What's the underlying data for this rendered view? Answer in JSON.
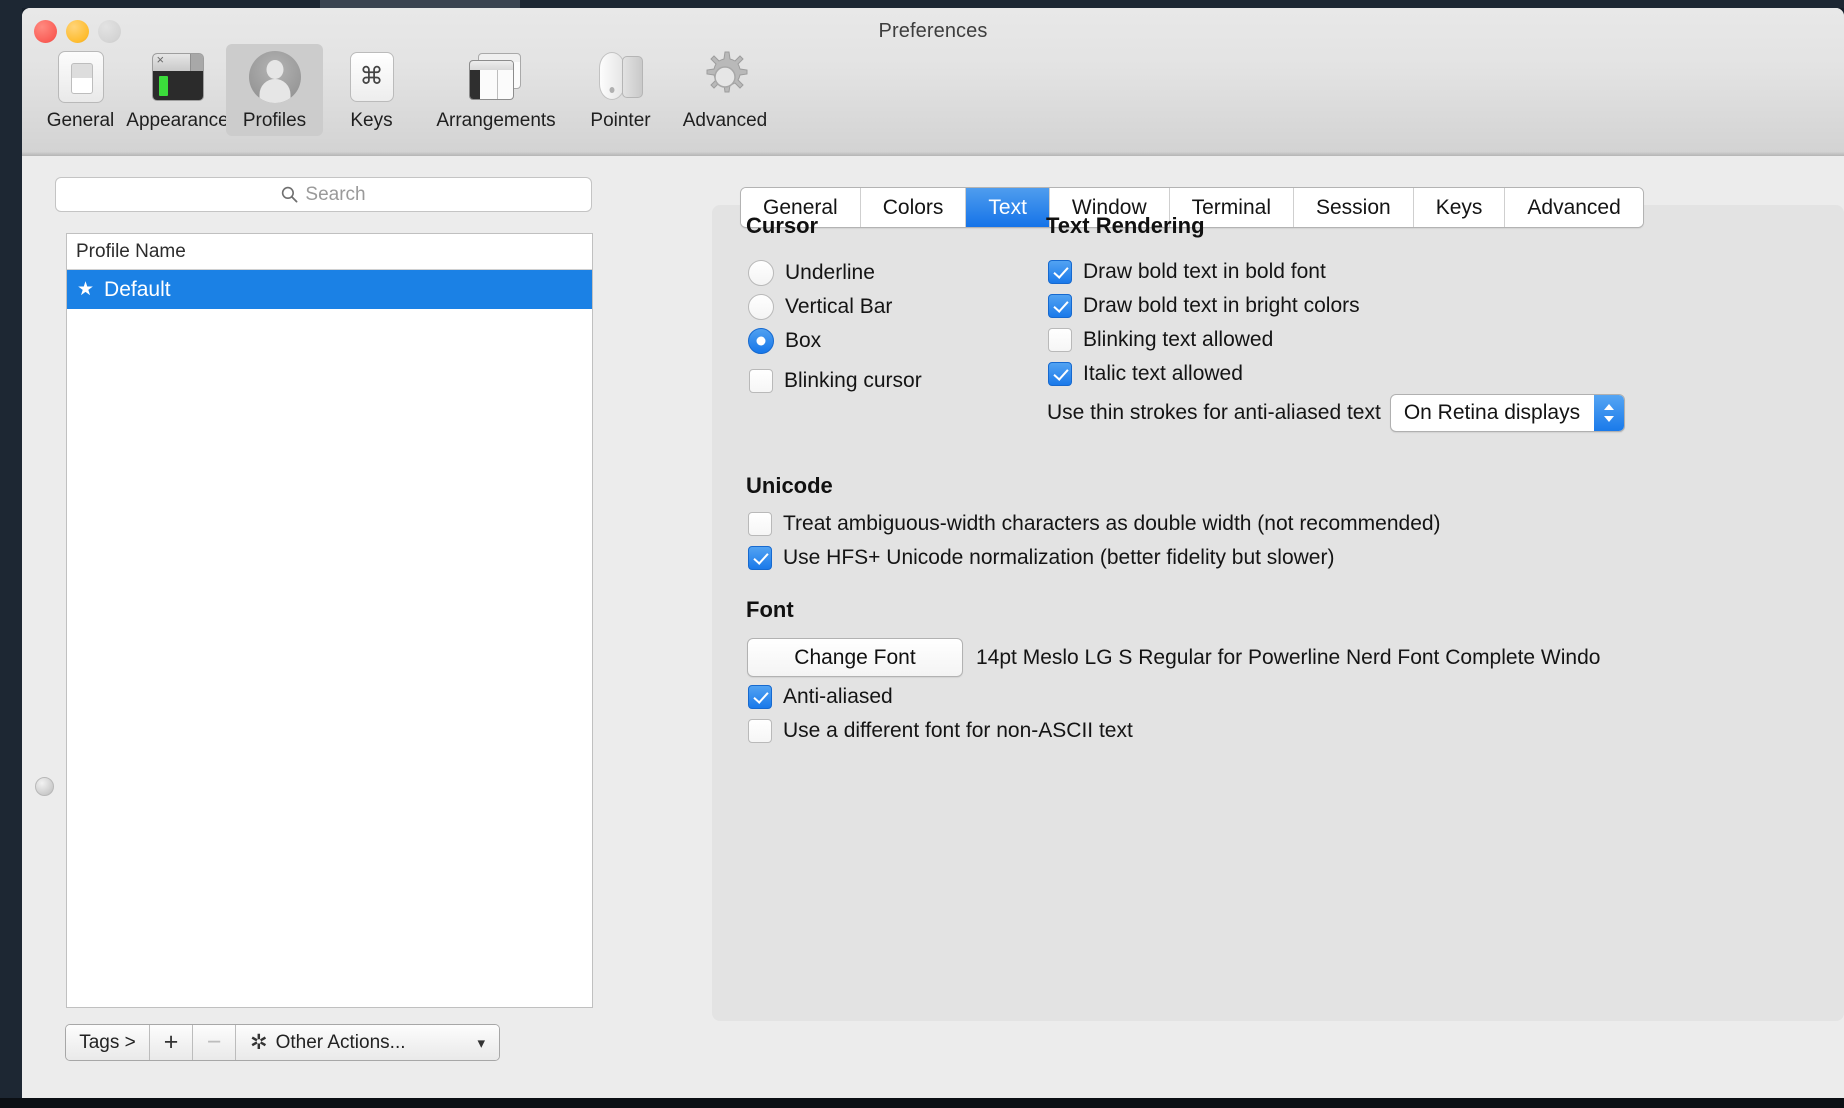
{
  "window": {
    "title": "Preferences",
    "traffic_lights": [
      "close",
      "minimize",
      "zoom"
    ]
  },
  "toolbar": {
    "items": [
      {
        "label": "General",
        "icon": "general-icon",
        "selected": false
      },
      {
        "label": "Appearance",
        "icon": "appearance-icon",
        "selected": false
      },
      {
        "label": "Profiles",
        "icon": "profiles-icon",
        "selected": true
      },
      {
        "label": "Keys",
        "icon": "keys-icon",
        "selected": false
      },
      {
        "label": "Arrangements",
        "icon": "arrangements-icon",
        "selected": false
      },
      {
        "label": "Pointer",
        "icon": "pointer-icon",
        "selected": false
      },
      {
        "label": "Advanced",
        "icon": "advanced-icon",
        "selected": false
      }
    ]
  },
  "sidebar": {
    "search": {
      "placeholder": "Search",
      "value": ""
    },
    "table": {
      "column_header": "Profile Name",
      "rows": [
        {
          "star": "★",
          "name": "Default",
          "selected": true
        }
      ]
    },
    "bottom_bar": {
      "tags_label": "Tags >",
      "add_label": "+",
      "remove_label": "−",
      "other_actions_label": "Other Actions...",
      "chevron": "⌄"
    }
  },
  "tabs": [
    {
      "label": "General",
      "active": false
    },
    {
      "label": "Colors",
      "active": false
    },
    {
      "label": "Text",
      "active": true
    },
    {
      "label": "Window",
      "active": false
    },
    {
      "label": "Terminal",
      "active": false
    },
    {
      "label": "Session",
      "active": false
    },
    {
      "label": "Keys",
      "active": false
    },
    {
      "label": "Advanced",
      "active": false
    }
  ],
  "sections": {
    "cursor": {
      "title": "Cursor",
      "radios": [
        {
          "label": "Underline",
          "checked": false
        },
        {
          "label": "Vertical Bar",
          "checked": false
        },
        {
          "label": "Box",
          "checked": true
        }
      ],
      "blinking": {
        "label": "Blinking cursor",
        "checked": false
      }
    },
    "text_rendering": {
      "title": "Text Rendering",
      "checkboxes": [
        {
          "label": "Draw bold text in bold font",
          "checked": true
        },
        {
          "label": "Draw bold text in bright colors",
          "checked": true
        },
        {
          "label": "Blinking text allowed",
          "checked": false
        },
        {
          "label": "Italic text allowed",
          "checked": true
        }
      ],
      "thin_strokes": {
        "label": "Use thin strokes for anti-aliased text",
        "selected_option": "On Retina displays"
      }
    },
    "unicode": {
      "title": "Unicode",
      "checkboxes": [
        {
          "label": "Treat ambiguous-width characters as double width (not recommended)",
          "checked": false
        },
        {
          "label": "Use HFS+ Unicode normalization (better fidelity but slower)",
          "checked": true
        }
      ]
    },
    "font": {
      "title": "Font",
      "change_font_label": "Change Font",
      "font_description": "14pt Meslo LG S Regular for Powerline Nerd Font Complete Windo",
      "checkboxes": [
        {
          "label": "Anti-aliased",
          "checked": true
        },
        {
          "label": "Use a different font for non-ASCII text",
          "checked": false
        }
      ]
    }
  },
  "colors": {
    "accent_blue": "#1b81e5",
    "tab_active": "#1573e8",
    "control_blue": "#1a79ea",
    "window_chrome": "#e8e8e8",
    "panel_bg": "#e3e3e3"
  }
}
